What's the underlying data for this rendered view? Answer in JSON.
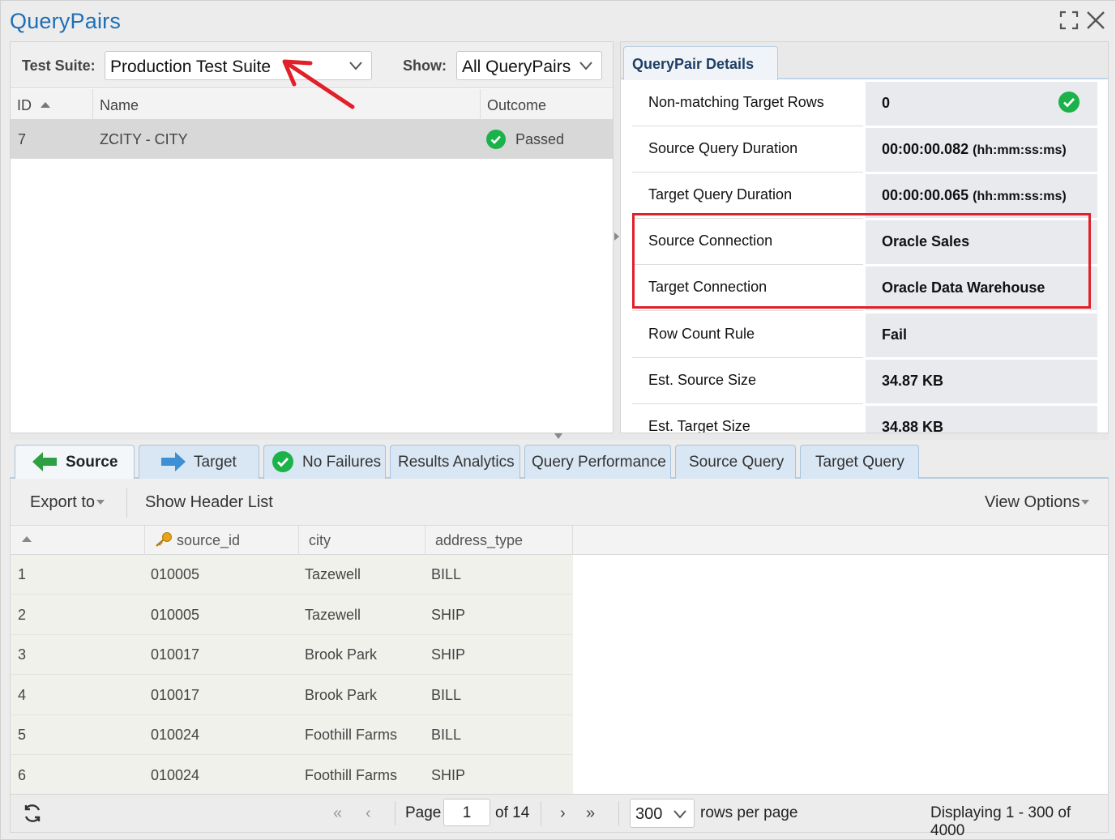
{
  "window": {
    "title": "QueryPairs"
  },
  "filters": {
    "test_suite_label": "Test Suite:",
    "test_suite_value": "Production Test Suite",
    "show_label": "Show:",
    "show_value": "All QueryPairs"
  },
  "querypair_grid": {
    "columns": [
      "ID",
      "Name",
      "Outcome"
    ],
    "rows": [
      {
        "id": "7",
        "name": "ZCITY - CITY",
        "outcome": "Passed"
      }
    ]
  },
  "details": {
    "tab_label": "QueryPair Details",
    "rows": [
      {
        "label": "Non-matching Target Rows",
        "value": "0",
        "unit": ""
      },
      {
        "label": "Source Query Duration",
        "value": "00:00:00.082",
        "unit": "(hh:mm:ss:ms)"
      },
      {
        "label": "Target Query Duration",
        "value": "00:00:00.065",
        "unit": "(hh:mm:ss:ms)"
      },
      {
        "label": "Source Connection",
        "value": "Oracle Sales",
        "unit": ""
      },
      {
        "label": "Target Connection",
        "value": "Oracle Data Warehouse",
        "unit": ""
      },
      {
        "label": "Row Count Rule",
        "value": "Fail",
        "unit": ""
      },
      {
        "label": "Est. Source Size",
        "value": "34.87 KB",
        "unit": ""
      },
      {
        "label": "Est. Target Size",
        "value": "34.88 KB",
        "unit": ""
      }
    ]
  },
  "tabs": {
    "source": "Source",
    "target": "Target",
    "no_failures": "No Failures",
    "results_analytics": "Results Analytics",
    "query_performance": "Query Performance",
    "source_query": "Source Query",
    "target_query": "Target Query"
  },
  "toolbar": {
    "export_label": "Export to",
    "show_header_label": "Show Header List",
    "view_options_label": "View Options"
  },
  "data_grid": {
    "columns": [
      "source_id",
      "city",
      "address_type"
    ],
    "rows": [
      {
        "n": "1",
        "source_id": "010005",
        "city": "Tazewell",
        "address_type": "BILL"
      },
      {
        "n": "2",
        "source_id": "010005",
        "city": "Tazewell",
        "address_type": "SHIP"
      },
      {
        "n": "3",
        "source_id": "010017",
        "city": "Brook Park",
        "address_type": "SHIP"
      },
      {
        "n": "4",
        "source_id": "010017",
        "city": "Brook Park",
        "address_type": "BILL"
      },
      {
        "n": "5",
        "source_id": "010024",
        "city": "Foothill Farms",
        "address_type": "BILL"
      },
      {
        "n": "6",
        "source_id": "010024",
        "city": "Foothill Farms",
        "address_type": "SHIP"
      }
    ]
  },
  "pager": {
    "page_label": "Page",
    "page_value": "1",
    "of_label": "of 14",
    "rows_per_page_value": "300",
    "rows_per_page_label": "rows per page",
    "displaying": "Displaying 1 - 300 of 4000"
  },
  "colors": {
    "title": "#1f6fb5",
    "passed_green": "#1cb24a",
    "highlight_red": "#e0202a",
    "annotation_arrow": "#e0202a",
    "tab_blue": "#d9e6f3"
  },
  "icons": [
    "maximize-icon",
    "close-icon",
    "chevron-down-icon",
    "check-circle-icon",
    "arrow-left-green-icon",
    "arrow-right-blue-icon",
    "key-icon",
    "refresh-icon"
  ]
}
